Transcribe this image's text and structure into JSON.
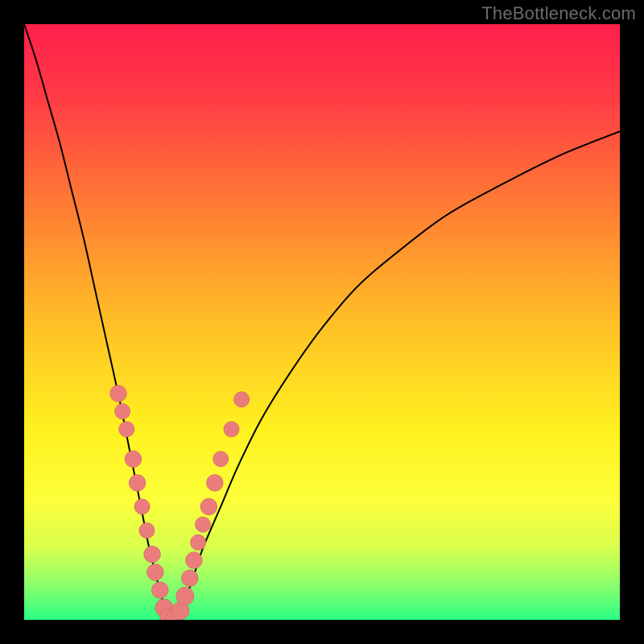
{
  "watermark": "TheBottleneck.com",
  "colors": {
    "frame": "#000000",
    "curve_stroke": "#000000",
    "marker_fill": "#eb7c7c",
    "marker_stroke": "#c95b5b",
    "gradient_stops": [
      {
        "offset": 0.0,
        "color": "#ff1f4b"
      },
      {
        "offset": 0.12,
        "color": "#ff3a45"
      },
      {
        "offset": 0.3,
        "color": "#ff7a34"
      },
      {
        "offset": 0.5,
        "color": "#ffbf26"
      },
      {
        "offset": 0.68,
        "color": "#fff11f"
      },
      {
        "offset": 0.8,
        "color": "#fdff3a"
      },
      {
        "offset": 0.88,
        "color": "#d8ff4e"
      },
      {
        "offset": 0.94,
        "color": "#8cff6a"
      },
      {
        "offset": 1.0,
        "color": "#2bff85"
      }
    ]
  },
  "chart_data": {
    "type": "line",
    "title": "",
    "xlabel": "",
    "ylabel": "",
    "xlim": [
      0,
      100
    ],
    "ylim": [
      0,
      100
    ],
    "grid": false,
    "series": [
      {
        "name": "bottleneck-curve",
        "x": [
          0,
          2,
          4,
          6,
          8,
          10,
          12,
          14,
          16,
          17,
          18,
          19,
          20,
          21,
          22,
          23,
          24,
          25,
          26,
          28,
          30,
          33,
          36,
          40,
          45,
          50,
          56,
          63,
          71,
          80,
          90,
          100
        ],
        "y": [
          100,
          94,
          87,
          80,
          72,
          64,
          55,
          46,
          37,
          32,
          27,
          22,
          17,
          12,
          8,
          4,
          1,
          0,
          1,
          6,
          12,
          19,
          26,
          34,
          42,
          49,
          56,
          62,
          68,
          73,
          78,
          82
        ]
      }
    ],
    "markers": [
      {
        "x": 15.8,
        "y": 38,
        "r": 1.4
      },
      {
        "x": 16.5,
        "y": 35,
        "r": 1.3
      },
      {
        "x": 17.2,
        "y": 32,
        "r": 1.3
      },
      {
        "x": 18.3,
        "y": 27,
        "r": 1.4
      },
      {
        "x": 19.0,
        "y": 23,
        "r": 1.4
      },
      {
        "x": 19.8,
        "y": 19,
        "r": 1.3
      },
      {
        "x": 20.6,
        "y": 15,
        "r": 1.3
      },
      {
        "x": 21.5,
        "y": 11,
        "r": 1.4
      },
      {
        "x": 22.0,
        "y": 8,
        "r": 1.4
      },
      {
        "x": 22.8,
        "y": 5,
        "r": 1.4
      },
      {
        "x": 23.5,
        "y": 2,
        "r": 1.5
      },
      {
        "x": 24.3,
        "y": 0.5,
        "r": 1.5
      },
      {
        "x": 25.2,
        "y": 0.3,
        "r": 1.5
      },
      {
        "x": 26.2,
        "y": 1.5,
        "r": 1.5
      },
      {
        "x": 27.0,
        "y": 4,
        "r": 1.5
      },
      {
        "x": 27.8,
        "y": 7,
        "r": 1.4
      },
      {
        "x": 28.5,
        "y": 10,
        "r": 1.4
      },
      {
        "x": 29.2,
        "y": 13,
        "r": 1.3
      },
      {
        "x": 30.0,
        "y": 16,
        "r": 1.3
      },
      {
        "x": 31.0,
        "y": 19,
        "r": 1.4
      },
      {
        "x": 32.0,
        "y": 23,
        "r": 1.4
      },
      {
        "x": 33.0,
        "y": 27,
        "r": 1.3
      },
      {
        "x": 34.8,
        "y": 32,
        "r": 1.3
      },
      {
        "x": 36.5,
        "y": 37,
        "r": 1.3
      }
    ]
  }
}
